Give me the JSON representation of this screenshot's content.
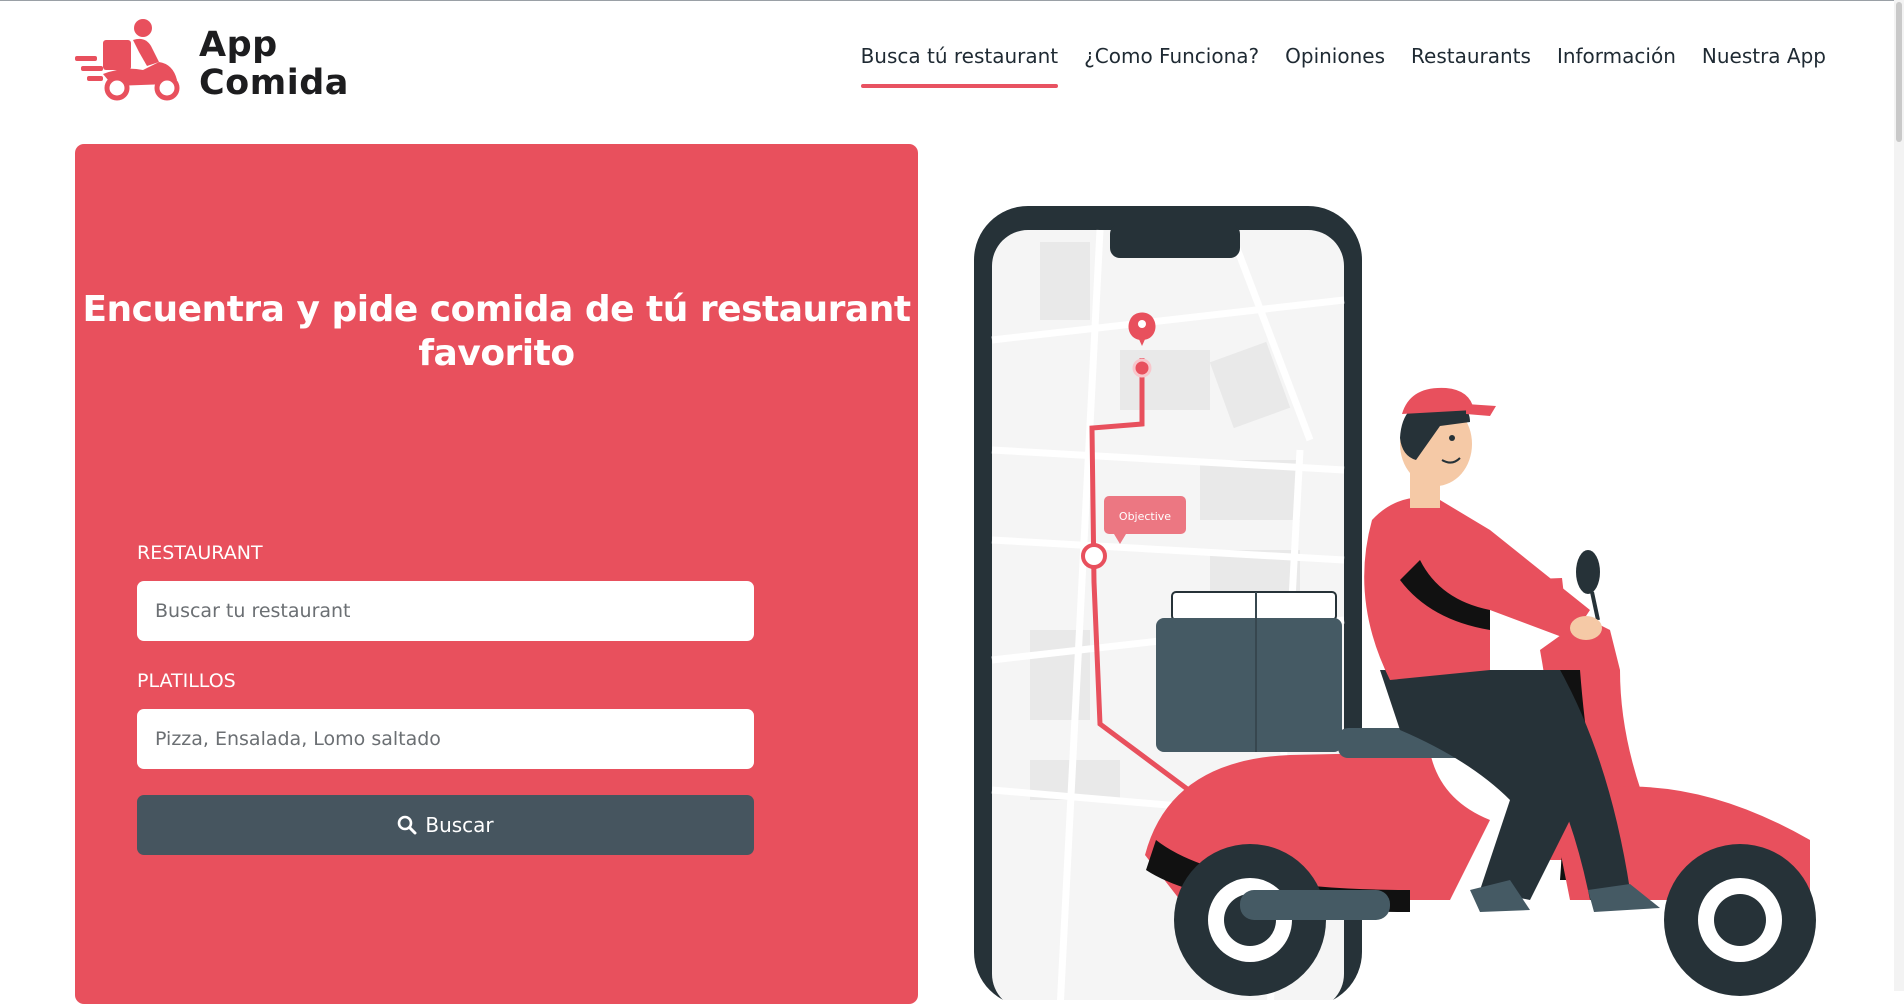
{
  "brand": {
    "line1": "App",
    "line2": "Comida",
    "accent": "#e8505d",
    "dark": "#1d1d1f"
  },
  "nav": {
    "items": [
      {
        "label": "Busca tú restaurant",
        "active": true
      },
      {
        "label": "¿Como Funciona?"
      },
      {
        "label": "Opiniones"
      },
      {
        "label": "Restaurants"
      },
      {
        "label": "Información"
      },
      {
        "label": "Nuestra App"
      }
    ]
  },
  "search": {
    "heading": "Encuentra y pide comida de tú restaurant favorito",
    "restaurant_label": "RESTAURANT",
    "restaurant_placeholder": "Buscar tu restaurant",
    "platillos_label": "PLATILLOS",
    "platillos_placeholder": "Pizza, Ensalada, Lomo saltado",
    "button_label": "Buscar",
    "button_icon": "search-icon",
    "panel_color": "#e8505d",
    "button_color": "#46555f"
  },
  "illustration": {
    "map_bubble": "Objective"
  }
}
